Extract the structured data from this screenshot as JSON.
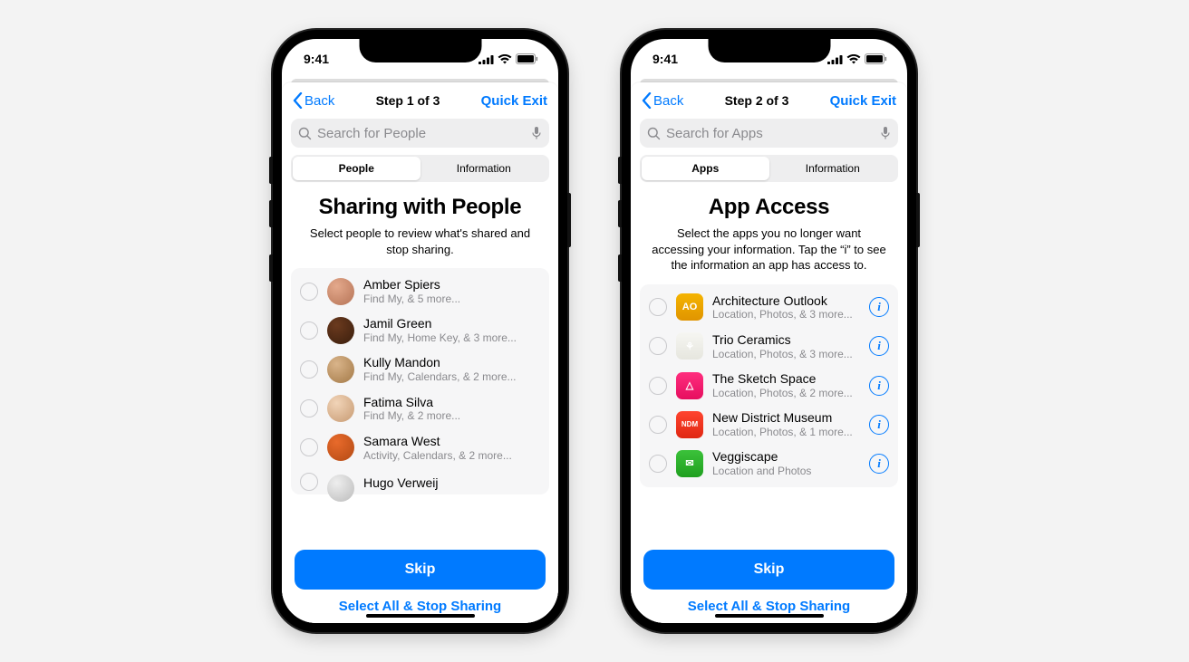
{
  "status": {
    "time": "9:41"
  },
  "phones": [
    {
      "nav": {
        "back": "Back",
        "title": "Step 1 of 3",
        "exit": "Quick Exit"
      },
      "search": {
        "placeholder": "Search for People"
      },
      "segments": [
        "People",
        "Information"
      ],
      "heading": "Sharing with People",
      "subtext": "Select people to review what's shared and stop sharing.",
      "rows": [
        {
          "name": "Amber Spiers",
          "detail": "Find My, & 5 more..."
        },
        {
          "name": "Jamil Green",
          "detail": "Find My, Home Key, & 3 more..."
        },
        {
          "name": "Kully Mandon",
          "detail": "Find My, Calendars, & 2 more..."
        },
        {
          "name": "Fatima Silva",
          "detail": "Find My, & 2 more..."
        },
        {
          "name": "Samara West",
          "detail": "Activity, Calendars, & 2 more..."
        },
        {
          "name": "Hugo Verweij",
          "detail": ""
        }
      ],
      "footer": {
        "primary": "Skip",
        "secondary": "Select All & Stop Sharing"
      }
    },
    {
      "nav": {
        "back": "Back",
        "title": "Step 2 of 3",
        "exit": "Quick Exit"
      },
      "search": {
        "placeholder": "Search for Apps"
      },
      "segments": [
        "Apps",
        "Information"
      ],
      "heading": "App Access",
      "subtext": "Select the apps you no longer want accessing your information. Tap the “i” to see the information an app has access to.",
      "rows": [
        {
          "name": "Architecture Outlook",
          "detail": "Location, Photos, & 3 more...",
          "badge": "AO"
        },
        {
          "name": "Trio Ceramics",
          "detail": "Location, Photos, & 3 more...",
          "badge": "⚘"
        },
        {
          "name": "The Sketch Space",
          "detail": "Location, Photos, & 2 more...",
          "badge": "△"
        },
        {
          "name": "New District Museum",
          "detail": "Location, Photos, & 1 more...",
          "badge": "NDM"
        },
        {
          "name": "Veggiscape",
          "detail": "Location and Photos",
          "badge": "✉"
        }
      ],
      "footer": {
        "primary": "Skip",
        "secondary": "Select All & Stop Sharing"
      }
    }
  ]
}
